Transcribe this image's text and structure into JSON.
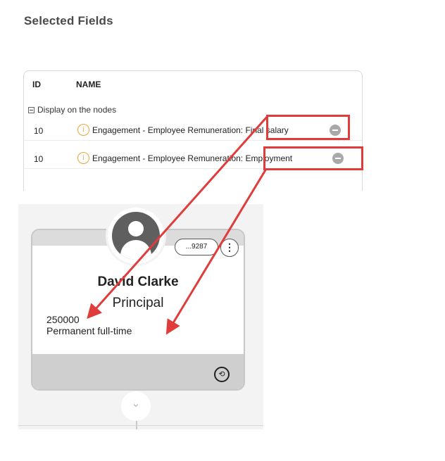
{
  "page": {
    "heading": "Selected Fields"
  },
  "fields_table": {
    "columns": {
      "id": "ID",
      "name": "NAME"
    },
    "group_label": "Display on the nodes",
    "rows": [
      {
        "id": "10",
        "label": "Engagement - Employee Remuneration: Final salary"
      },
      {
        "id": "10",
        "label": "Engagement - Employee Remuneration: Employment"
      }
    ]
  },
  "card": {
    "id_badge": "...9287",
    "more_glyph": "⋮",
    "name": "David Clarke",
    "title": "Principal",
    "salary": "250000",
    "employment": "Permanent full-time",
    "icons": [
      "user-avatar-icon",
      "more-options-icon",
      "swap-user-icon",
      "chevron-down-icon"
    ]
  },
  "colors": {
    "highlight": "#e03c3c",
    "info": "#e8a33d",
    "card_border": "#c7c7c7"
  }
}
